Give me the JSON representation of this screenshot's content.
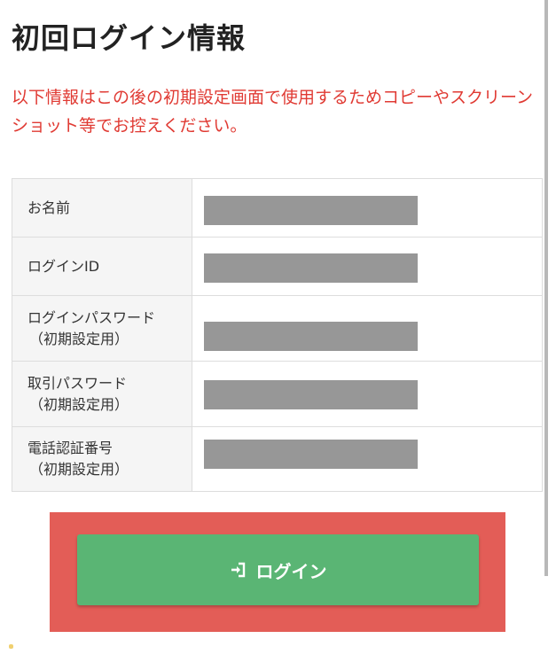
{
  "page": {
    "title": "初回ログイン情報",
    "notice": "以下情報はこの後の初期設定画面で使用するためコピーやスクリーンショット等でお控えください。"
  },
  "table": {
    "rows": [
      {
        "label": "お名前",
        "sub": ""
      },
      {
        "label": "ログインID",
        "sub": ""
      },
      {
        "label": "ログインパスワード",
        "sub": "（初期設定用）"
      },
      {
        "label": "取引パスワード",
        "sub": "（初期設定用）"
      },
      {
        "label": "電話認証番号",
        "sub": "（初期設定用）"
      }
    ]
  },
  "login_button": {
    "label": "ログイン",
    "icon": "login-icon"
  },
  "colors": {
    "notice_text": "#e03a33",
    "button": "#5ab574",
    "highlight": "#e35d57",
    "redaction": "#979797"
  }
}
